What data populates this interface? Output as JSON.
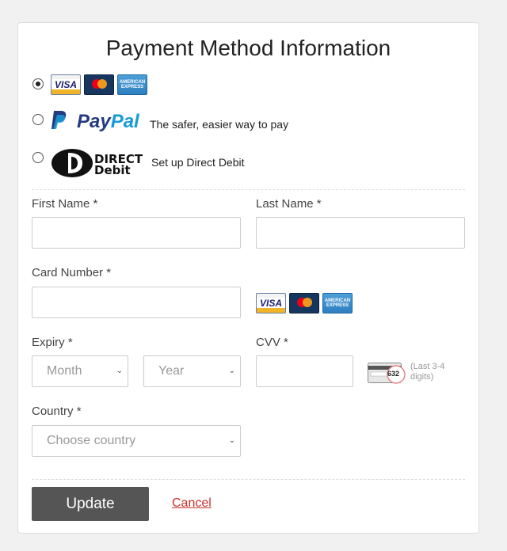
{
  "form": {
    "title": "Payment Method Information",
    "payment_options": [
      {
        "id": "card",
        "selected": true,
        "logos": [
          "VISA",
          "MasterCard",
          "AMERICAN EXPRESS"
        ]
      },
      {
        "id": "paypal",
        "selected": false,
        "logo_word_1": "Pay",
        "logo_word_2": "Pal",
        "tagline": "The safer, easier way to pay"
      },
      {
        "id": "direct-debit",
        "selected": false,
        "logo_line_1": "DIRECT",
        "logo_line_2": "Debit",
        "tagline": "Set up Direct Debit"
      }
    ],
    "first_name": {
      "label": "First Name *",
      "value": ""
    },
    "last_name": {
      "label": "Last Name *",
      "value": ""
    },
    "card_number": {
      "label": "Card Number *",
      "value": ""
    },
    "expiry": {
      "label": "Expiry *",
      "month_placeholder": "Month",
      "year_placeholder": "Year"
    },
    "cvv": {
      "label": "CVV *",
      "value": "",
      "sample_code": "632",
      "note": "(Last 3-4 digits)"
    },
    "country": {
      "label": "Country *",
      "placeholder": "Choose country"
    },
    "actions": {
      "update_label": "Update",
      "cancel_label": "Cancel"
    }
  },
  "colors": {
    "accent_link": "#c9302c",
    "button_bg": "#555555",
    "page_bg": "#f1f1f1",
    "card_bg": "#ffffff"
  },
  "icons": [
    "visa-logo",
    "mastercard-logo",
    "amex-logo",
    "paypal-logo",
    "direct-debit-logo",
    "cvv-card-icon",
    "chevron-down-icon"
  ]
}
